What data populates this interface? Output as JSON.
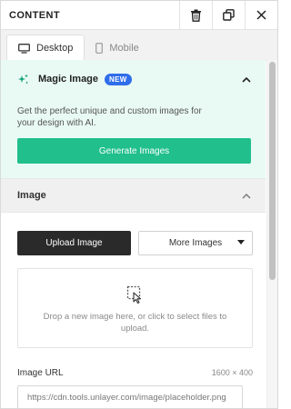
{
  "header": {
    "title": "CONTENT"
  },
  "tabs": [
    {
      "label": "Desktop",
      "icon": "monitor-icon",
      "active": true
    },
    {
      "label": "Mobile",
      "icon": "mobile-icon",
      "active": false
    }
  ],
  "magic": {
    "title": "Magic Image",
    "badge": "NEW",
    "description": "Get the perfect unique and custom images for your design with AI.",
    "button": "Generate Images"
  },
  "image_section": {
    "title": "Image",
    "upload_button": "Upload Image",
    "more_button": "More Images",
    "drop_text": "Drop a new image here, or click to select files to upload.",
    "url_label": "Image URL",
    "dimensions": "1600 × 400",
    "url_value": "https://cdn.tools.unlayer.com/image/placeholder.png"
  },
  "colors": {
    "accent_green": "#21bf8b",
    "magic_bg": "#e9faf5",
    "badge_blue": "#2f6dea",
    "dark_button": "#2a2a2a"
  }
}
